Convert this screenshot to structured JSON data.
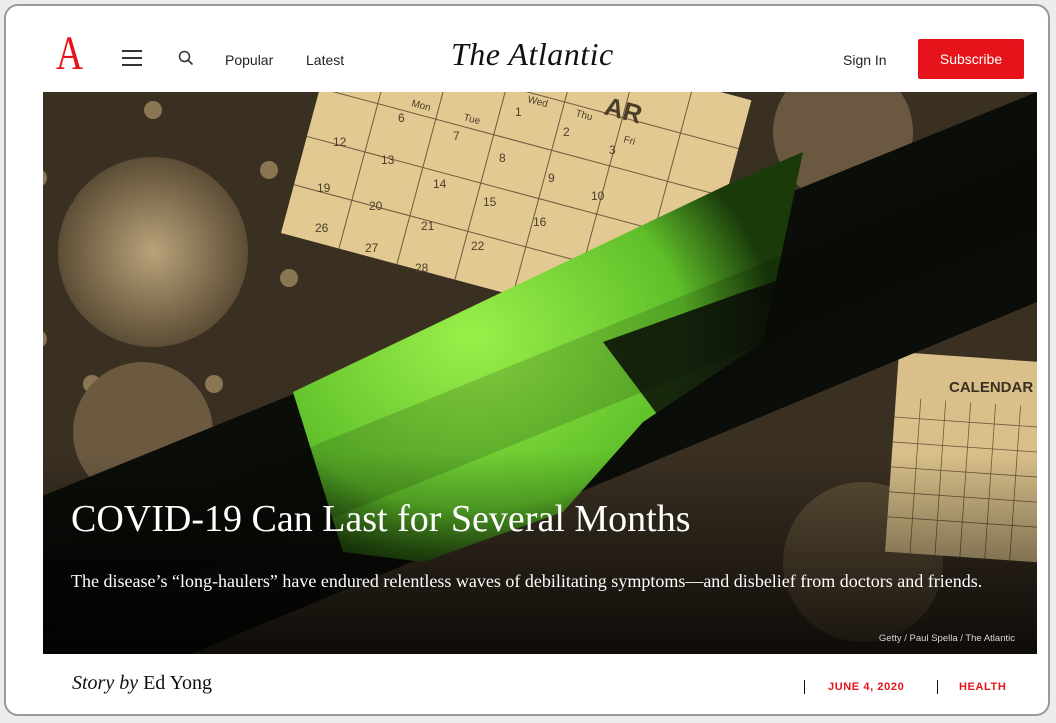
{
  "header": {
    "logo_letter": "A",
    "brand": "The Atlantic",
    "nav": {
      "popular": "Popular",
      "latest": "Latest"
    },
    "sign_in": "Sign In",
    "subscribe": "Subscribe"
  },
  "hero": {
    "title": "COVID-19 Can Last for Several Months",
    "dek": "The disease’s “long-haulers” have endured relentless waves of debilitating symptoms—and disbelief from doctors and friends.",
    "credit": "Getty / Paul Spella / The Atlantic",
    "calendar_word": "CALENDAR",
    "calendar_top_word": "AR",
    "weekdays": [
      "Mon",
      "Tue",
      "Wed",
      "Thu",
      "Fri"
    ],
    "calendar_numbers": [
      "6",
      "7",
      "8",
      "9",
      "10",
      "12",
      "13",
      "14",
      "15",
      "16",
      "19",
      "20",
      "21",
      "22",
      "26",
      "27",
      "28",
      "1",
      "2",
      "3"
    ]
  },
  "byline": {
    "prefix": "Story by",
    "author": "Ed Yong",
    "date": "JUNE 4, 2020",
    "section": "HEALTH"
  },
  "colors": {
    "brand_red": "#e7131a",
    "hero_green": "#7fd63a",
    "sepia": "#e2c992"
  },
  "icons": [
    "menu-icon",
    "search-icon",
    "virus-icon"
  ]
}
